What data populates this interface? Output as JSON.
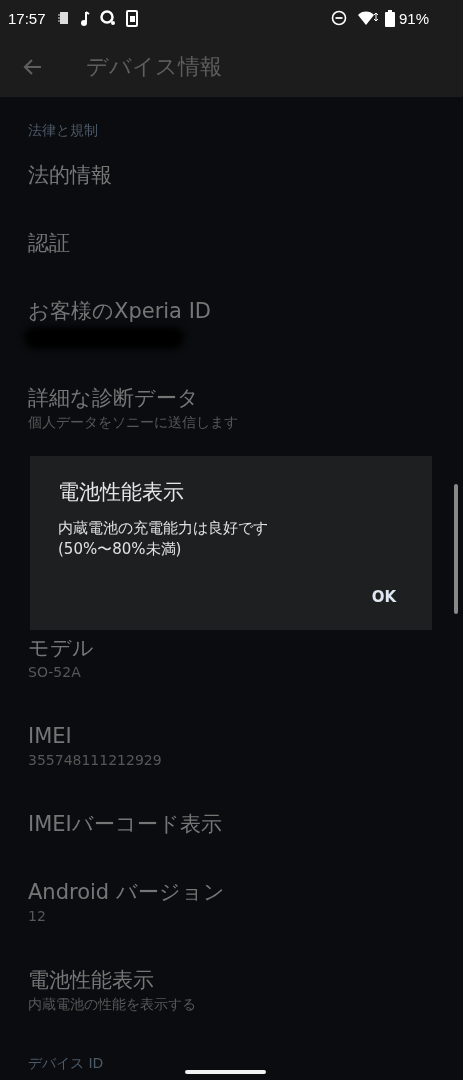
{
  "status_bar": {
    "time": "17:57",
    "battery": "91%"
  },
  "app_bar": {
    "title": "デバイス情報"
  },
  "sections": [
    {
      "header": "法律と規制",
      "items": [
        {
          "title": "法的情報"
        },
        {
          "title": "認証"
        },
        {
          "title": "お客様のXperia ID",
          "kind": "redacted"
        },
        {
          "title": "詳細な診断データ",
          "subtitle": "個人データをソニーに送信します"
        }
      ]
    },
    {
      "items": [
        {
          "title": "モデル",
          "subtitle": "SO-52A"
        },
        {
          "title": "IMEI",
          "subtitle": "355748111212929"
        },
        {
          "title": "IMEIバーコード表示"
        },
        {
          "title": "Android バージョン",
          "subtitle": "12"
        },
        {
          "title": "電池性能表示",
          "subtitle": "内蔵電池の性能を表示する"
        }
      ]
    },
    {
      "header": "デバイス ID"
    }
  ],
  "dialog": {
    "title": "電池性能表示",
    "message": "内蔵電池の充電能力は良好です\n(50%〜80%未満)",
    "buttons": [
      "OK"
    ]
  }
}
